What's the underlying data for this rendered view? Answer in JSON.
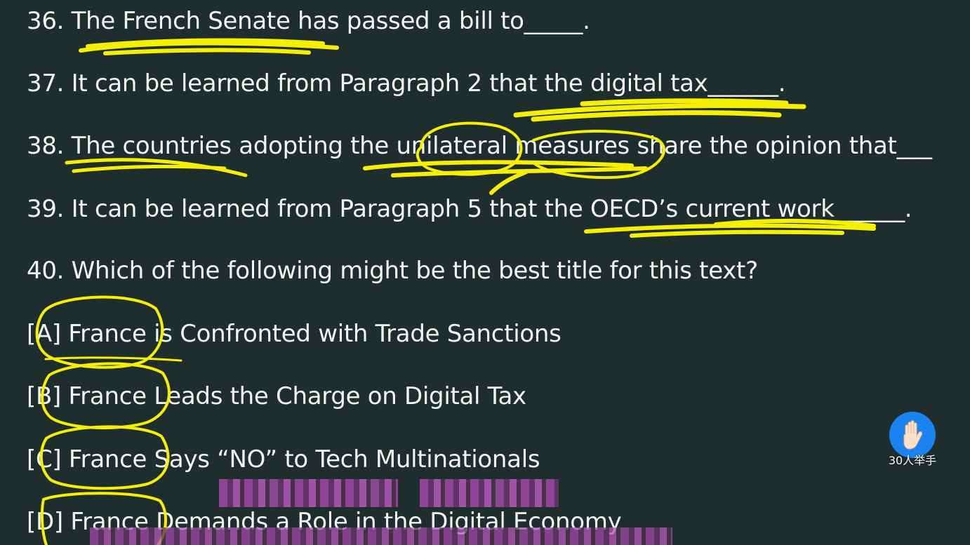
{
  "questions": {
    "q36": "36. The French Senate has passed a bill to_____.",
    "q37": "37. It can be learned from Paragraph 2 that the digital tax______.",
    "q38": "38. The countries adopting the unilateral measures share the opinion that___",
    "q39": "39. It can be learned from Paragraph 5 that the OECD’s current work______.",
    "q40": "40. Which of the following might be the best title for this text?"
  },
  "options": {
    "a": "[A] France is Confronted with Trade Sanctions",
    "b": "[B] France Leads the Charge on Digital Tax",
    "c": "[C] France Says “NO” to Tech Multinationals",
    "d": "[D] France Demands a Role in the Digital Economy"
  },
  "raise_hand": {
    "label": "30人举手",
    "icon": "raised-hand-icon"
  },
  "colors": {
    "background": "#1f2e2d",
    "text": "#f3f3f3",
    "highlighter": "#f4f000",
    "hand_button": "#1a83f0"
  }
}
